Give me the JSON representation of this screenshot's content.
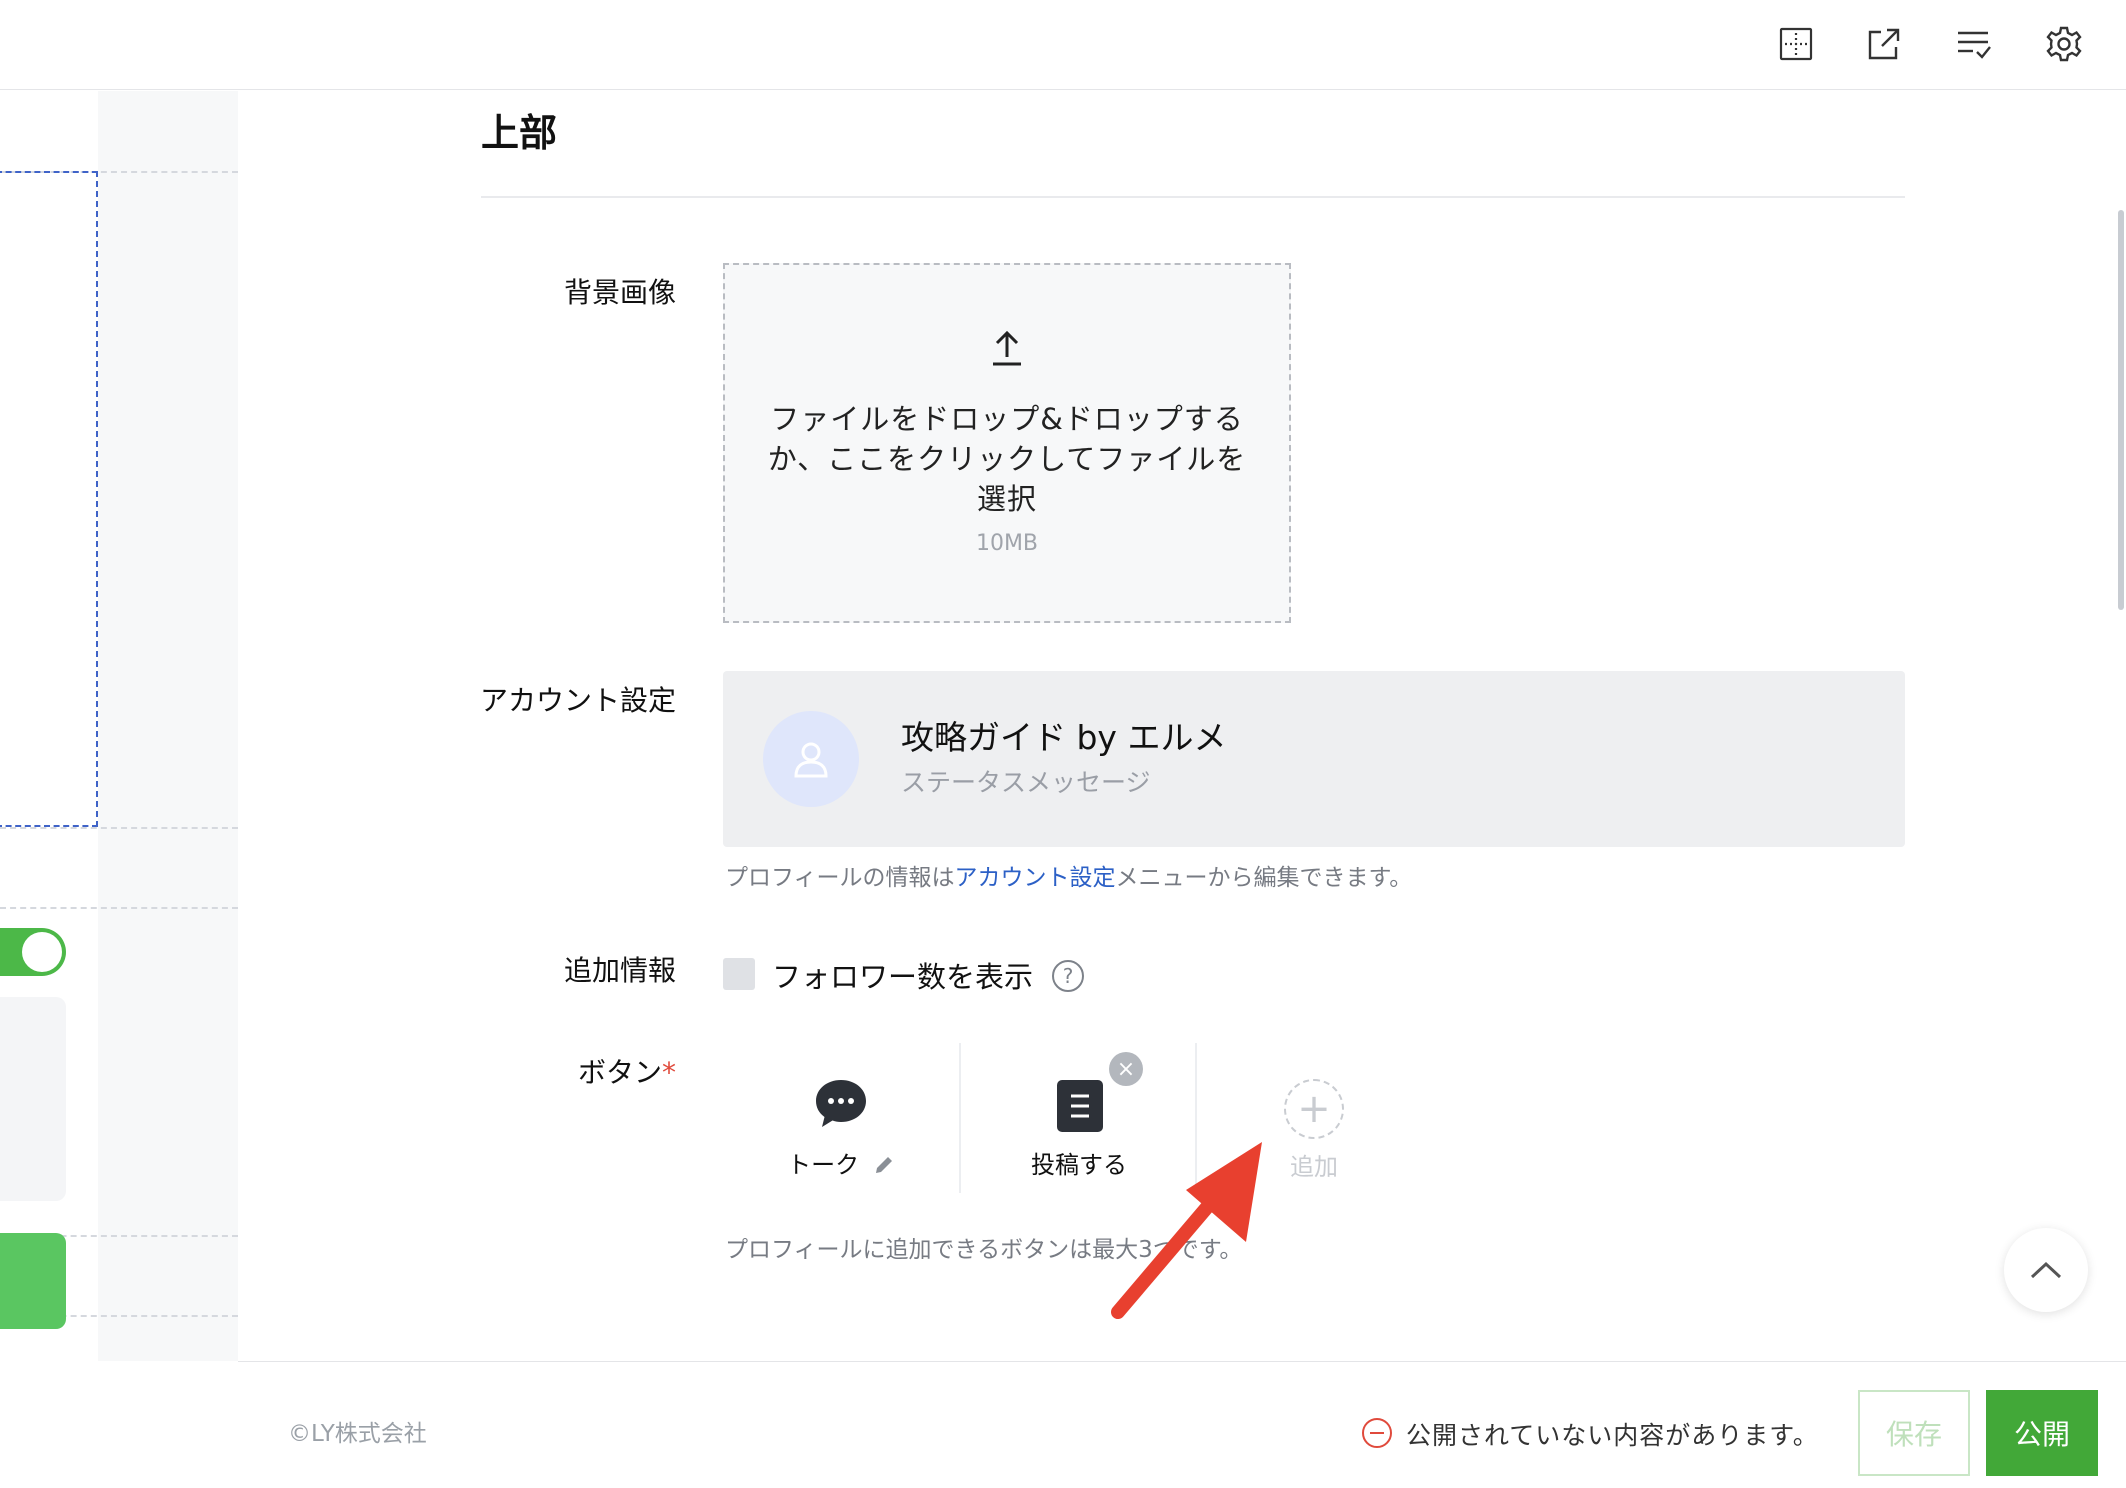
{
  "topbar": {
    "icons": [
      "grid-layout-icon",
      "external-link-icon",
      "checklist-icon",
      "gear-icon"
    ]
  },
  "section": {
    "title": "上部"
  },
  "background_image": {
    "label": "背景画像",
    "upload_text": "ファイルをドロップ&ドロップするか、ここをクリックしてファイルを選択",
    "size_limit": "10MB"
  },
  "account": {
    "label": "アカウント設定",
    "name": "攻略ガイド by エルメ",
    "status": "ステータスメッセージ",
    "help_prefix": "プロフィールの情報は",
    "help_link": "アカウント設定",
    "help_suffix": "メニューから編集できます。"
  },
  "additional_info": {
    "label": "追加情報",
    "checkbox_label": "フォロワー数を表示",
    "help_glyph": "?"
  },
  "buttons_section": {
    "label": "ボタン",
    "required_mark": "*",
    "items": [
      {
        "label": "トーク",
        "icon": "chat-bubble-icon"
      },
      {
        "label": "投稿する",
        "icon": "document-icon"
      }
    ],
    "add_label": "追加",
    "help": "プロフィールに追加できるボタンは最大3つです。"
  },
  "footer": {
    "copyright": "©LY株式会社",
    "warning": "公開されていない内容があります。",
    "save_label": "保存",
    "publish_label": "公開"
  },
  "colors": {
    "primary_green": "#42a838",
    "link_blue": "#2c60c6",
    "error_red": "#e04a3c",
    "annotation_red": "#e8402f"
  }
}
